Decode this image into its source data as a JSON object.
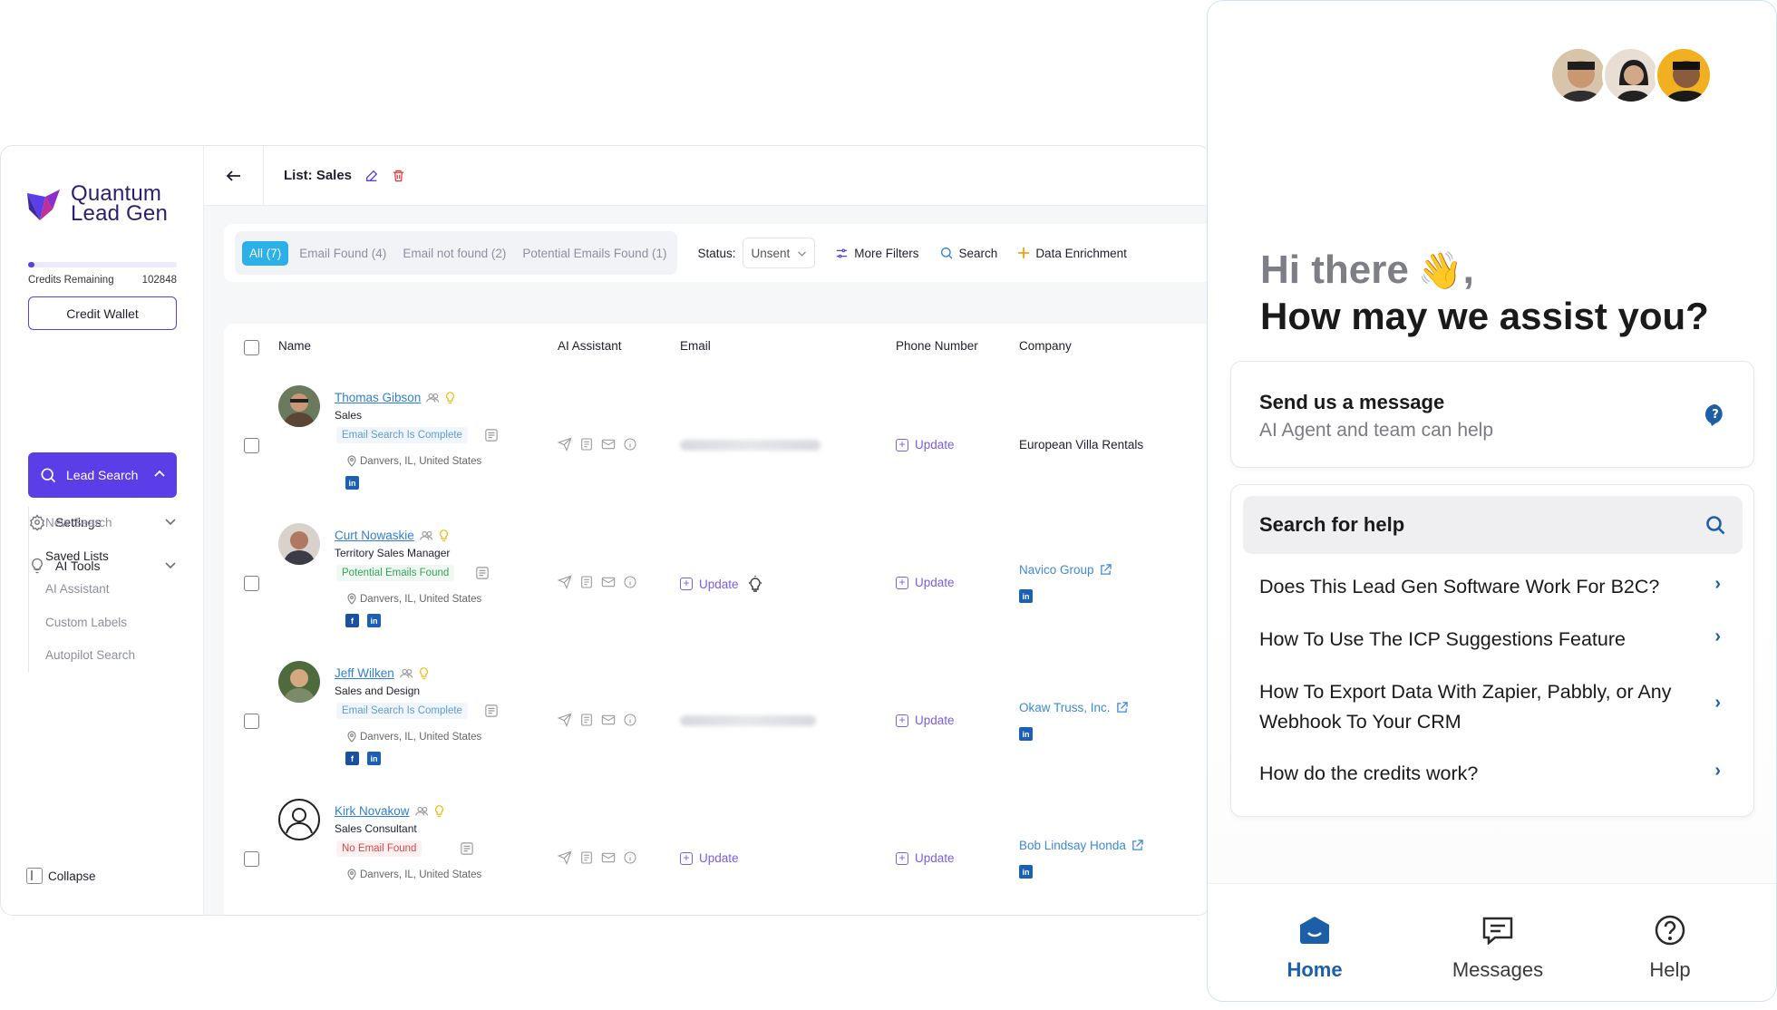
{
  "sidebar": {
    "logo_line1": "Quantum",
    "logo_line2": "Lead Gen",
    "credits_label": "Credits Remaining",
    "credits_value": "102848",
    "credit_wallet": "Credit Wallet",
    "settings": "Settings",
    "ai_tools": "AI Tools",
    "lead_search": "Lead Search",
    "sub_items": [
      "New Search",
      "Saved Lists",
      "AI Assistant",
      "Custom Labels",
      "Autopilot Search"
    ],
    "collapse": "Collapse"
  },
  "topbar": {
    "title": "List: Sales"
  },
  "filters": {
    "tabs": [
      "All (7)",
      "Email Found (4)",
      "Email not found (2)",
      "Potential Emails Found (1)"
    ],
    "status_label": "Status:",
    "status_value": "Unsent",
    "more_filters": "More Filters",
    "search": "Search",
    "data_enrichment": "Data Enrichment"
  },
  "table": {
    "headers": [
      "Name",
      "AI Assistant",
      "Email",
      "Phone Number",
      "Company"
    ],
    "update_label": "Update",
    "rows": [
      {
        "name": "Thomas Gibson",
        "title": "Sales",
        "badge": "Email Search Is Complete",
        "location": "Danvers, IL, United States",
        "company": "European Villa Rentals"
      },
      {
        "name": "Curt Nowaskie",
        "title": "Territory Sales Manager",
        "badge": "Potential Emails Found",
        "location": "Danvers, IL, United States",
        "company": "Navico Group"
      },
      {
        "name": "Jeff Wilken",
        "title": "Sales and Design",
        "badge": "Email Search Is Complete",
        "location": "Danvers, IL, United States",
        "company": "Okaw Truss, Inc."
      },
      {
        "name": "Kirk Novakow",
        "title": "Sales Consultant",
        "badge": "No Email Found",
        "location": "Danvers, IL, United States",
        "company": "Bob Lindsay Honda"
      }
    ]
  },
  "widget": {
    "greeting": "Hi there",
    "wave": "👋",
    "comma": ",",
    "question": "How may we assist you?",
    "send_title": "Send us a message",
    "send_sub": "AI Agent and team can help",
    "search_help": "Search for help",
    "faqs": [
      "Does This Lead Gen Software Work For B2C?",
      "How To Use The ICP Suggestions Feature",
      "How To Export Data With Zapier, Pabbly, or Any Webhook To Your CRM",
      "How do the credits work?"
    ],
    "nav": [
      "Home",
      "Messages",
      "Help"
    ]
  },
  "colors": {
    "accent": "#5b3ee8",
    "tab_active": "#2bb0ea",
    "widget_accent": "#1c5fa8"
  }
}
